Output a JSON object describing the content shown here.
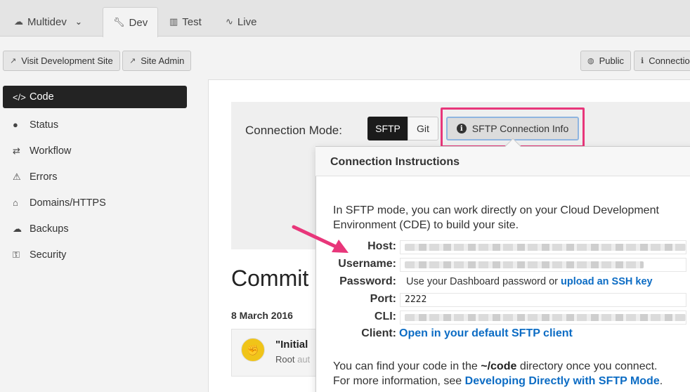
{
  "env_tabs": [
    {
      "label": "Multidev",
      "icon": "cloud-icon"
    },
    {
      "label": "Dev",
      "icon": "wrench-icon"
    },
    {
      "label": "Test",
      "icon": "bar-chart-icon"
    },
    {
      "label": "Live",
      "icon": "pulse-icon"
    }
  ],
  "toolbar": {
    "visit_label": "Visit Development Site",
    "admin_label": "Site Admin",
    "public_label": "Public",
    "connection_label": "Connection"
  },
  "sidebar": {
    "items": [
      {
        "label": "Code",
        "icon": "code-icon"
      },
      {
        "label": "Status",
        "icon": "info-icon"
      },
      {
        "label": "Workflow",
        "icon": "arrows-icon"
      },
      {
        "label": "Errors",
        "icon": "warning-icon"
      },
      {
        "label": "Domains/HTTPS",
        "icon": "home-icon"
      },
      {
        "label": "Backups",
        "icon": "cloud-upload-icon"
      },
      {
        "label": "Security",
        "icon": "key-icon"
      }
    ]
  },
  "connection": {
    "mode_label": "Connection Mode:",
    "sftp_label": "SFTP",
    "git_label": "Git",
    "info_button": "SFTP Connection Info"
  },
  "popover": {
    "title": "Connection Instructions",
    "intro": "In SFTP mode, you can work directly on your Cloud Development Environment (CDE) to build your site.",
    "host_label": "Host:",
    "username_label": "Username:",
    "password_label": "Password:",
    "password_text": "Use your Dashboard password or",
    "password_link": "upload an SSH key",
    "port_label": "Port:",
    "port_value": "2222",
    "cli_label": "CLI:",
    "client_label": "Client:",
    "client_link": "Open in your default SFTP client",
    "footer_1": "You can find your code in the",
    "footer_dir": "~/code",
    "footer_2": "directory once you connect.",
    "footer_3": "For more information, see",
    "footer_link": "Developing Directly with SFTP Mode",
    "footer_end": "."
  },
  "commits": {
    "heading": "Commit",
    "date": "8 March 2016",
    "message": "\"Initial",
    "author_prefix": "Root",
    "author_rest": "aut"
  },
  "colors": {
    "highlight": "#e8367a",
    "link": "#0c6cc4",
    "active_nav": "#232323"
  }
}
